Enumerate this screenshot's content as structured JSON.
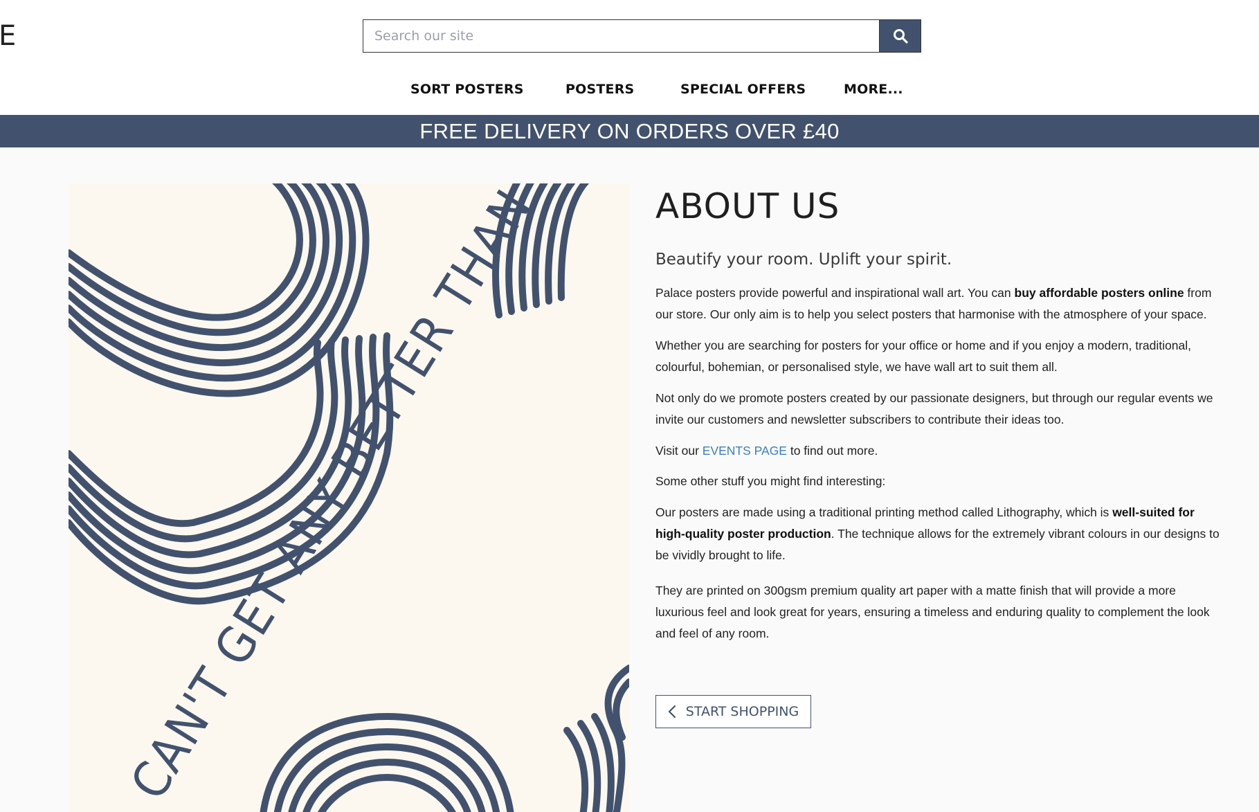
{
  "header": {
    "logo_fragment": "E",
    "search": {
      "placeholder": "Search our site",
      "button_icon": "search-icon"
    }
  },
  "nav": {
    "items": [
      {
        "label": "SORT POSTERS"
      },
      {
        "label": "POSTERS"
      },
      {
        "label": "SPECIAL OFFERS"
      },
      {
        "label": "MORE..."
      }
    ]
  },
  "banner": {
    "text": "FREE DELIVERY ON ORDERS OVER £40"
  },
  "poster": {
    "text": "CAN'T GET ANY BETTER THAN THIS",
    "colors": {
      "background": "#fcf8ef",
      "stripes": "#42526e"
    }
  },
  "about": {
    "title": "ABOUT US",
    "subtitle": "Beautify your room. Uplift your spirit.",
    "p1": {
      "a": "Palace posters provide powerful and inspirational wall art. You can ",
      "b": "buy affordable posters online",
      "c": " from our store. Our only aim is to help you select posters that harmonise with the atmosphere of your space."
    },
    "p2": "Whether you are searching for posters for your office or home and if you enjoy a modern, traditional, colourful, bohemian, or personalised style, we have wall art to suit them all.",
    "p3": "Not only do we promote posters created by our passionate designers, but through our regular events we invite our customers and newsletter subscribers to contribute their ideas too.",
    "p4": {
      "a": "Visit our ",
      "link": "EVENTS PAGE",
      "c": " to find out more."
    },
    "p5": "Some other stuff you might find interesting:",
    "p6": {
      "a": "Our posters are made using a traditional printing method called Lithography, which is ",
      "b": "well-suited for high-quality poster production",
      "c": ". The technique allows for the extremely vibrant colours in our designs to be vividly brought to life."
    },
    "p7": "They are printed on 300gsm premium quality art paper with a matte finish that will provide a more luxurious feel and look great for years, ensuring a timeless and enduring quality to complement the look and feel of any room.",
    "button": {
      "label": "START SHOPPING",
      "icon": "chevron-left-icon"
    }
  },
  "colors": {
    "brand": "#42526e",
    "link": "#3b7fbf"
  }
}
